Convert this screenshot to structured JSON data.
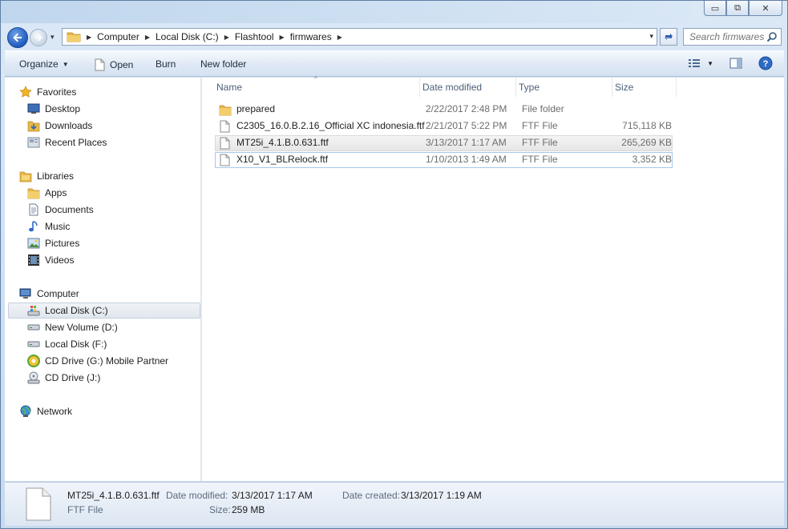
{
  "window": {
    "minimize_symbol": "▭",
    "maximize_symbol": "⧉",
    "close_symbol": "✕"
  },
  "address": {
    "crumbs": [
      "Computer",
      "Local Disk (C:)",
      "Flashtool",
      "firmwares"
    ],
    "dropdown_symbol": "▾"
  },
  "search": {
    "placeholder": "Search firmwares"
  },
  "toolbar": {
    "organize": "Organize",
    "open": "Open",
    "burn": "Burn",
    "new_folder": "New folder"
  },
  "sidebar": {
    "favorites_header": "Favorites",
    "favorites": [
      "Desktop",
      "Downloads",
      "Recent Places"
    ],
    "libraries_header": "Libraries",
    "libraries": [
      "Apps",
      "Documents",
      "Music",
      "Pictures",
      "Videos"
    ],
    "computer_header": "Computer",
    "drives": [
      "Local Disk (C:)",
      "New Volume (D:)",
      "Local Disk (F:)",
      "CD Drive (G:) Mobile Partner",
      "CD Drive (J:)"
    ],
    "network_header": "Network"
  },
  "columns": {
    "name": "Name",
    "date": "Date modified",
    "type": "Type",
    "size": "Size"
  },
  "files": [
    {
      "name": "prepared",
      "date": "2/22/2017 2:48 PM",
      "type": "File folder",
      "size": "",
      "icon": "folder-icon"
    },
    {
      "name": "C2305_16.0.B.2.16_Official XC indonesia.ftf",
      "date": "2/21/2017 5:22 PM",
      "type": "FTF File",
      "size": "715,118 KB",
      "icon": "file-icon"
    },
    {
      "name": "MT25i_4.1.B.0.631.ftf",
      "date": "3/13/2017 1:17 AM",
      "type": "FTF File",
      "size": "265,269 KB",
      "icon": "file-icon"
    },
    {
      "name": "X10_V1_BLRelock.ftf",
      "date": "1/10/2013 1:49 AM",
      "type": "FTF File",
      "size": "3,352 KB",
      "icon": "file-icon"
    }
  ],
  "details": {
    "filename": "MT25i_4.1.B.0.631.ftf",
    "filetype": "FTF File",
    "modified_label": "Date modified:",
    "modified_value": "3/13/2017 1:17 AM",
    "size_label": "Size:",
    "size_value": "259 MB",
    "created_label": "Date created:",
    "created_value": "3/13/2017 1:19 AM"
  },
  "colors": {
    "accent": "#1f5bbd",
    "selection_border": "#a8c8ea",
    "folder": "#e8b84a"
  }
}
